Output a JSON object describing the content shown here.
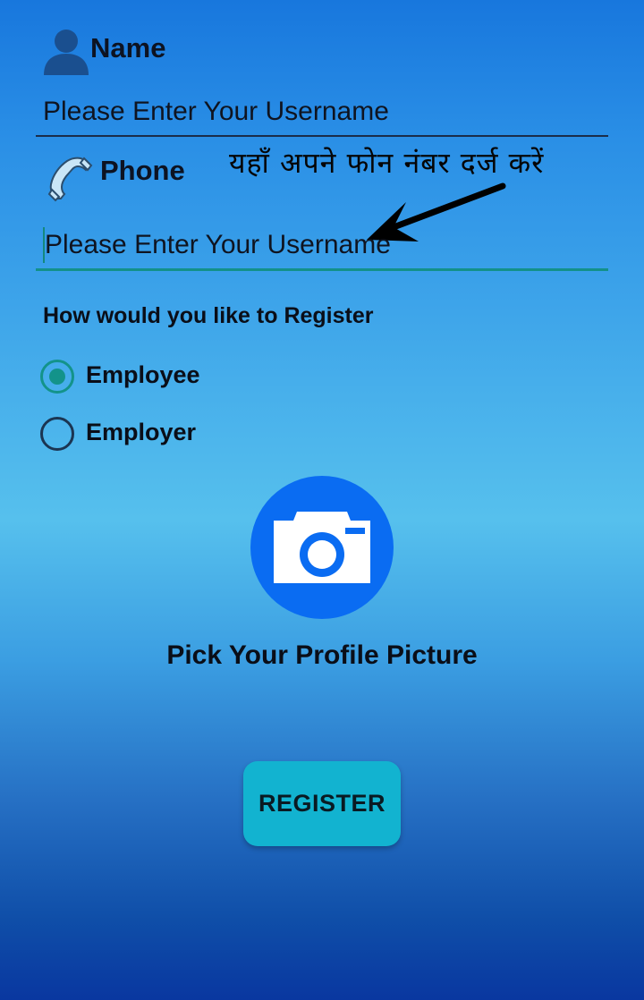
{
  "name_section": {
    "label": "Name",
    "icon": "user-icon",
    "field_value": "Please Enter Your Username"
  },
  "phone_section": {
    "label": "Phone",
    "icon": "phone-icon",
    "field_value": "Please Enter Your Username",
    "annotation": "यहाँ अपने फोन नंबर दर्ज करें"
  },
  "register_type": {
    "question": "How would you like to Register",
    "options": [
      {
        "label": "Employee",
        "selected": true
      },
      {
        "label": "Employer",
        "selected": false
      }
    ]
  },
  "profile_picture": {
    "icon": "camera-icon",
    "label": "Pick Your Profile Picture"
  },
  "register_button": {
    "label": "REGISTER"
  },
  "colors": {
    "accent": "#13938a",
    "camera_circle": "#0a6cf2",
    "button": "#12b3d0"
  }
}
